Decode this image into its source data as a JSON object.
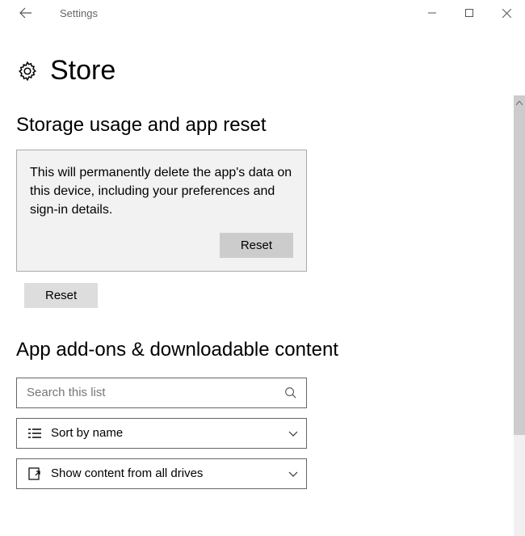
{
  "window": {
    "title": "Settings"
  },
  "header": {
    "title": "Store"
  },
  "section1": {
    "title": "Storage usage and app reset",
    "callout": {
      "text": "This will permanently delete the app's data on this device, including your preferences and sign-in details.",
      "confirm_label": "Reset"
    },
    "reset_label": "Reset"
  },
  "section2": {
    "title": "App add-ons & downloadable content",
    "search_placeholder": "Search this list",
    "sort_label": "Sort by name",
    "filter_label": "Show content from all drives"
  }
}
